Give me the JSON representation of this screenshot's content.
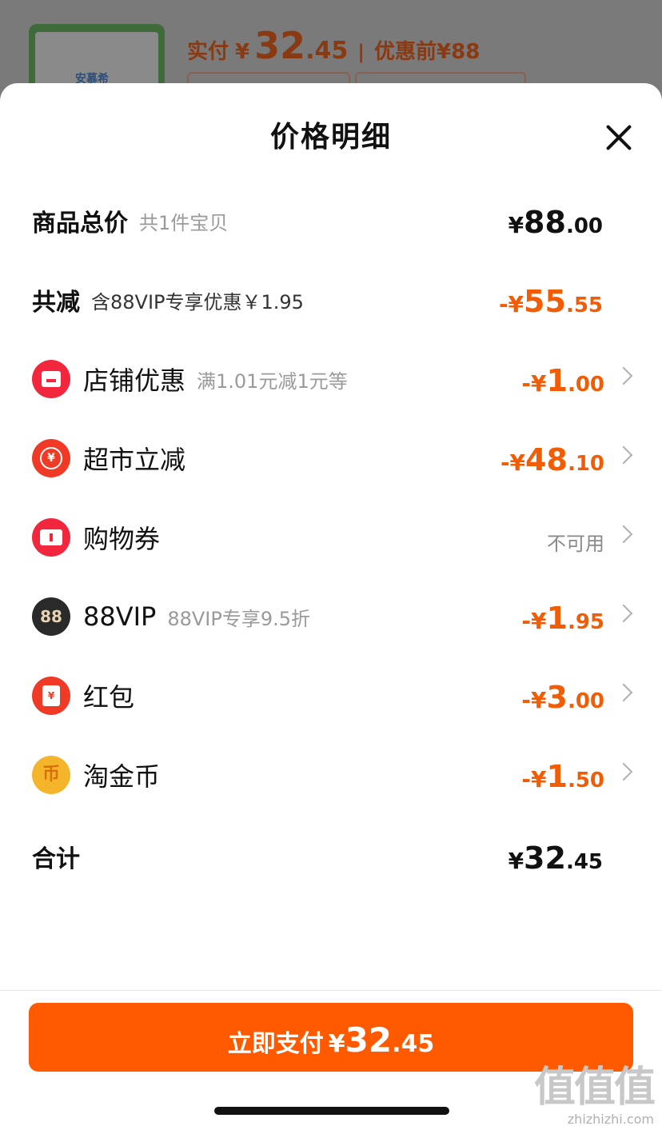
{
  "background": {
    "thumb_label": "安慕希",
    "paid_label": "实付",
    "currency": "¥",
    "paid_int": "32",
    "paid_dec": ".45",
    "separator": "|",
    "before_label": "优惠前¥88"
  },
  "sheet": {
    "title": "价格明细",
    "close_icon": "close-icon"
  },
  "rows": [
    {
      "id": "total",
      "label": "商品总价",
      "sub": "共1件宝贝",
      "sign": "¥",
      "int": "88",
      "dec": ".00",
      "color": "#111111"
    },
    {
      "id": "reduce",
      "label": "共减",
      "sub": "含88VIP专享优惠￥1.95",
      "sign": "-¥",
      "int": "55",
      "dec": ".55",
      "color": "#f25c05"
    },
    {
      "id": "shop",
      "icon": "shop-icon",
      "label": "店铺优惠",
      "sub": "满1.01元减1元等",
      "sign": "-¥",
      "int": "1",
      "dec": ".00",
      "color": "#f25c05"
    },
    {
      "id": "market",
      "icon": "yuan-discount-icon",
      "label": "超市立减",
      "sub": "",
      "sign": "-¥",
      "int": "48",
      "dec": ".10",
      "color": "#f25c05"
    },
    {
      "id": "coupon",
      "icon": "coupon-icon",
      "label": "购物券",
      "sub": "",
      "status": "不可用"
    },
    {
      "id": "vip",
      "icon": "vip-88-icon",
      "icon_text": "88",
      "label": "88VIP",
      "sub": "88VIP专享9.5折",
      "sign": "-¥",
      "int": "1",
      "dec": ".95",
      "color": "#f25c05"
    },
    {
      "id": "redpacket",
      "icon": "red-envelope-icon",
      "icon_text": "¥",
      "label": "红包",
      "sub": "",
      "sign": "-¥",
      "int": "3",
      "dec": ".00",
      "color": "#f25c05"
    },
    {
      "id": "coins",
      "icon": "gold-coin-icon",
      "icon_text": "币",
      "label": "淘金币",
      "sub": "",
      "sign": "-¥",
      "int": "1",
      "dec": ".50",
      "color": "#f25c05"
    },
    {
      "id": "sum",
      "label": "合计",
      "sub": "",
      "sign": "¥",
      "int": "32",
      "dec": ".45",
      "color": "#111111"
    }
  ],
  "pay_button": {
    "label": "立即支付",
    "sign": "¥",
    "int": "32",
    "dec": ".45",
    "color": "#ff5a00"
  },
  "watermark": {
    "logo": "值值值",
    "url": "zhizhizhi.com"
  }
}
